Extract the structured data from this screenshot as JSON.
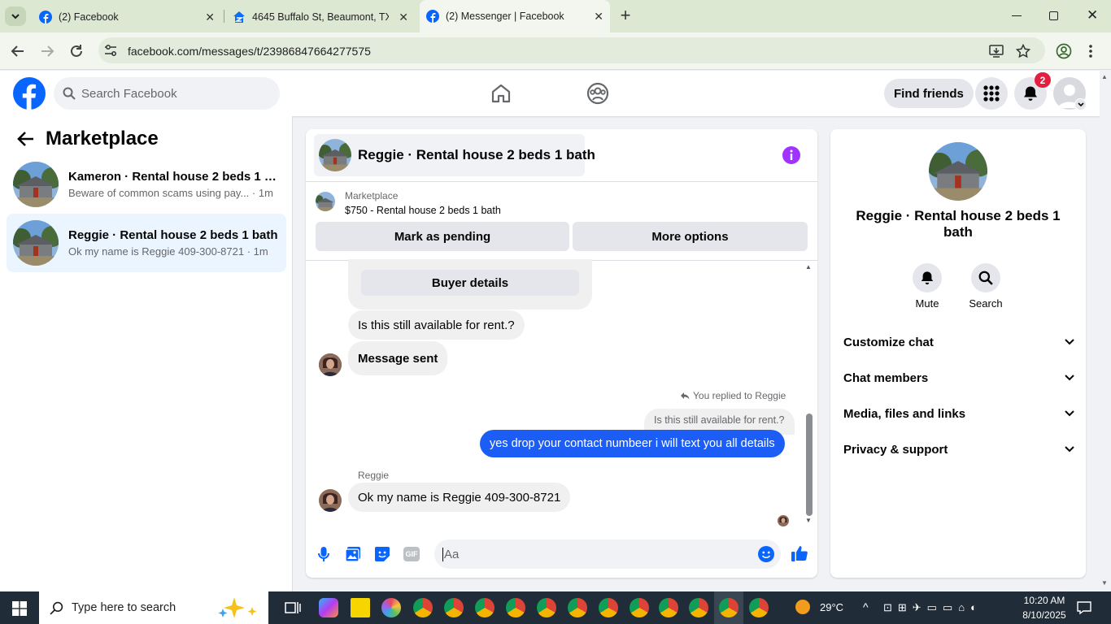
{
  "browser": {
    "tabs": [
      {
        "label": "(2) Facebook"
      },
      {
        "label": "4645 Buffalo St, Beaumont, TX 7"
      },
      {
        "label": "(2) Messenger | Facebook"
      }
    ],
    "url": "facebook.com/messages/t/23986847664277575"
  },
  "header": {
    "search_placeholder": "Search Facebook",
    "find_friends": "Find friends",
    "notification_count": "2"
  },
  "sidebar": {
    "title": "Marketplace",
    "conversations": [
      {
        "title": "Kameron · Rental house 2 beds 1 b...",
        "snippet": "Beware of common scams using pay...",
        "time": "· 1m"
      },
      {
        "title": "Reggie · Rental house 2 beds 1 bath",
        "snippet": "Ok my name is Reggie 409-300-8721",
        "time": "· 1m"
      }
    ]
  },
  "chat": {
    "title": "Reggie · Rental house 2 beds 1 bath",
    "listing_source": "Marketplace",
    "listing_desc": "$750 - Rental house 2 beds 1 bath",
    "mark_pending": "Mark as pending",
    "more_options": "More options",
    "buyer_details": "Buyer details",
    "messages": {
      "m1": "Is this still available for rent.?",
      "m2": "Message sent",
      "reply_note": "You replied to Reggie",
      "quoted": "Is this still available for rent.?",
      "sent": "yes drop your contact numbeer i will text you all details",
      "sender_name": "Reggie",
      "m3": "Ok my name is Reggie 409-300-8721"
    },
    "composer_placeholder": "Aa"
  },
  "info_panel": {
    "title": "Reggie · Rental house 2 beds 1 bath",
    "mute": "Mute",
    "search": "Search",
    "sections": [
      "Customize chat",
      "Chat members",
      "Media, files and links",
      "Privacy & support"
    ]
  },
  "taskbar": {
    "search_placeholder": "Type here to search",
    "temperature": "29°C",
    "time": "10:20 AM",
    "date": "8/10/2025"
  },
  "colors": {
    "facebook_blue": "#0866ff",
    "messenger_purple": "#a033ff",
    "sent_bubble": "#1c5ef5",
    "notification_red": "#e41e3f"
  }
}
